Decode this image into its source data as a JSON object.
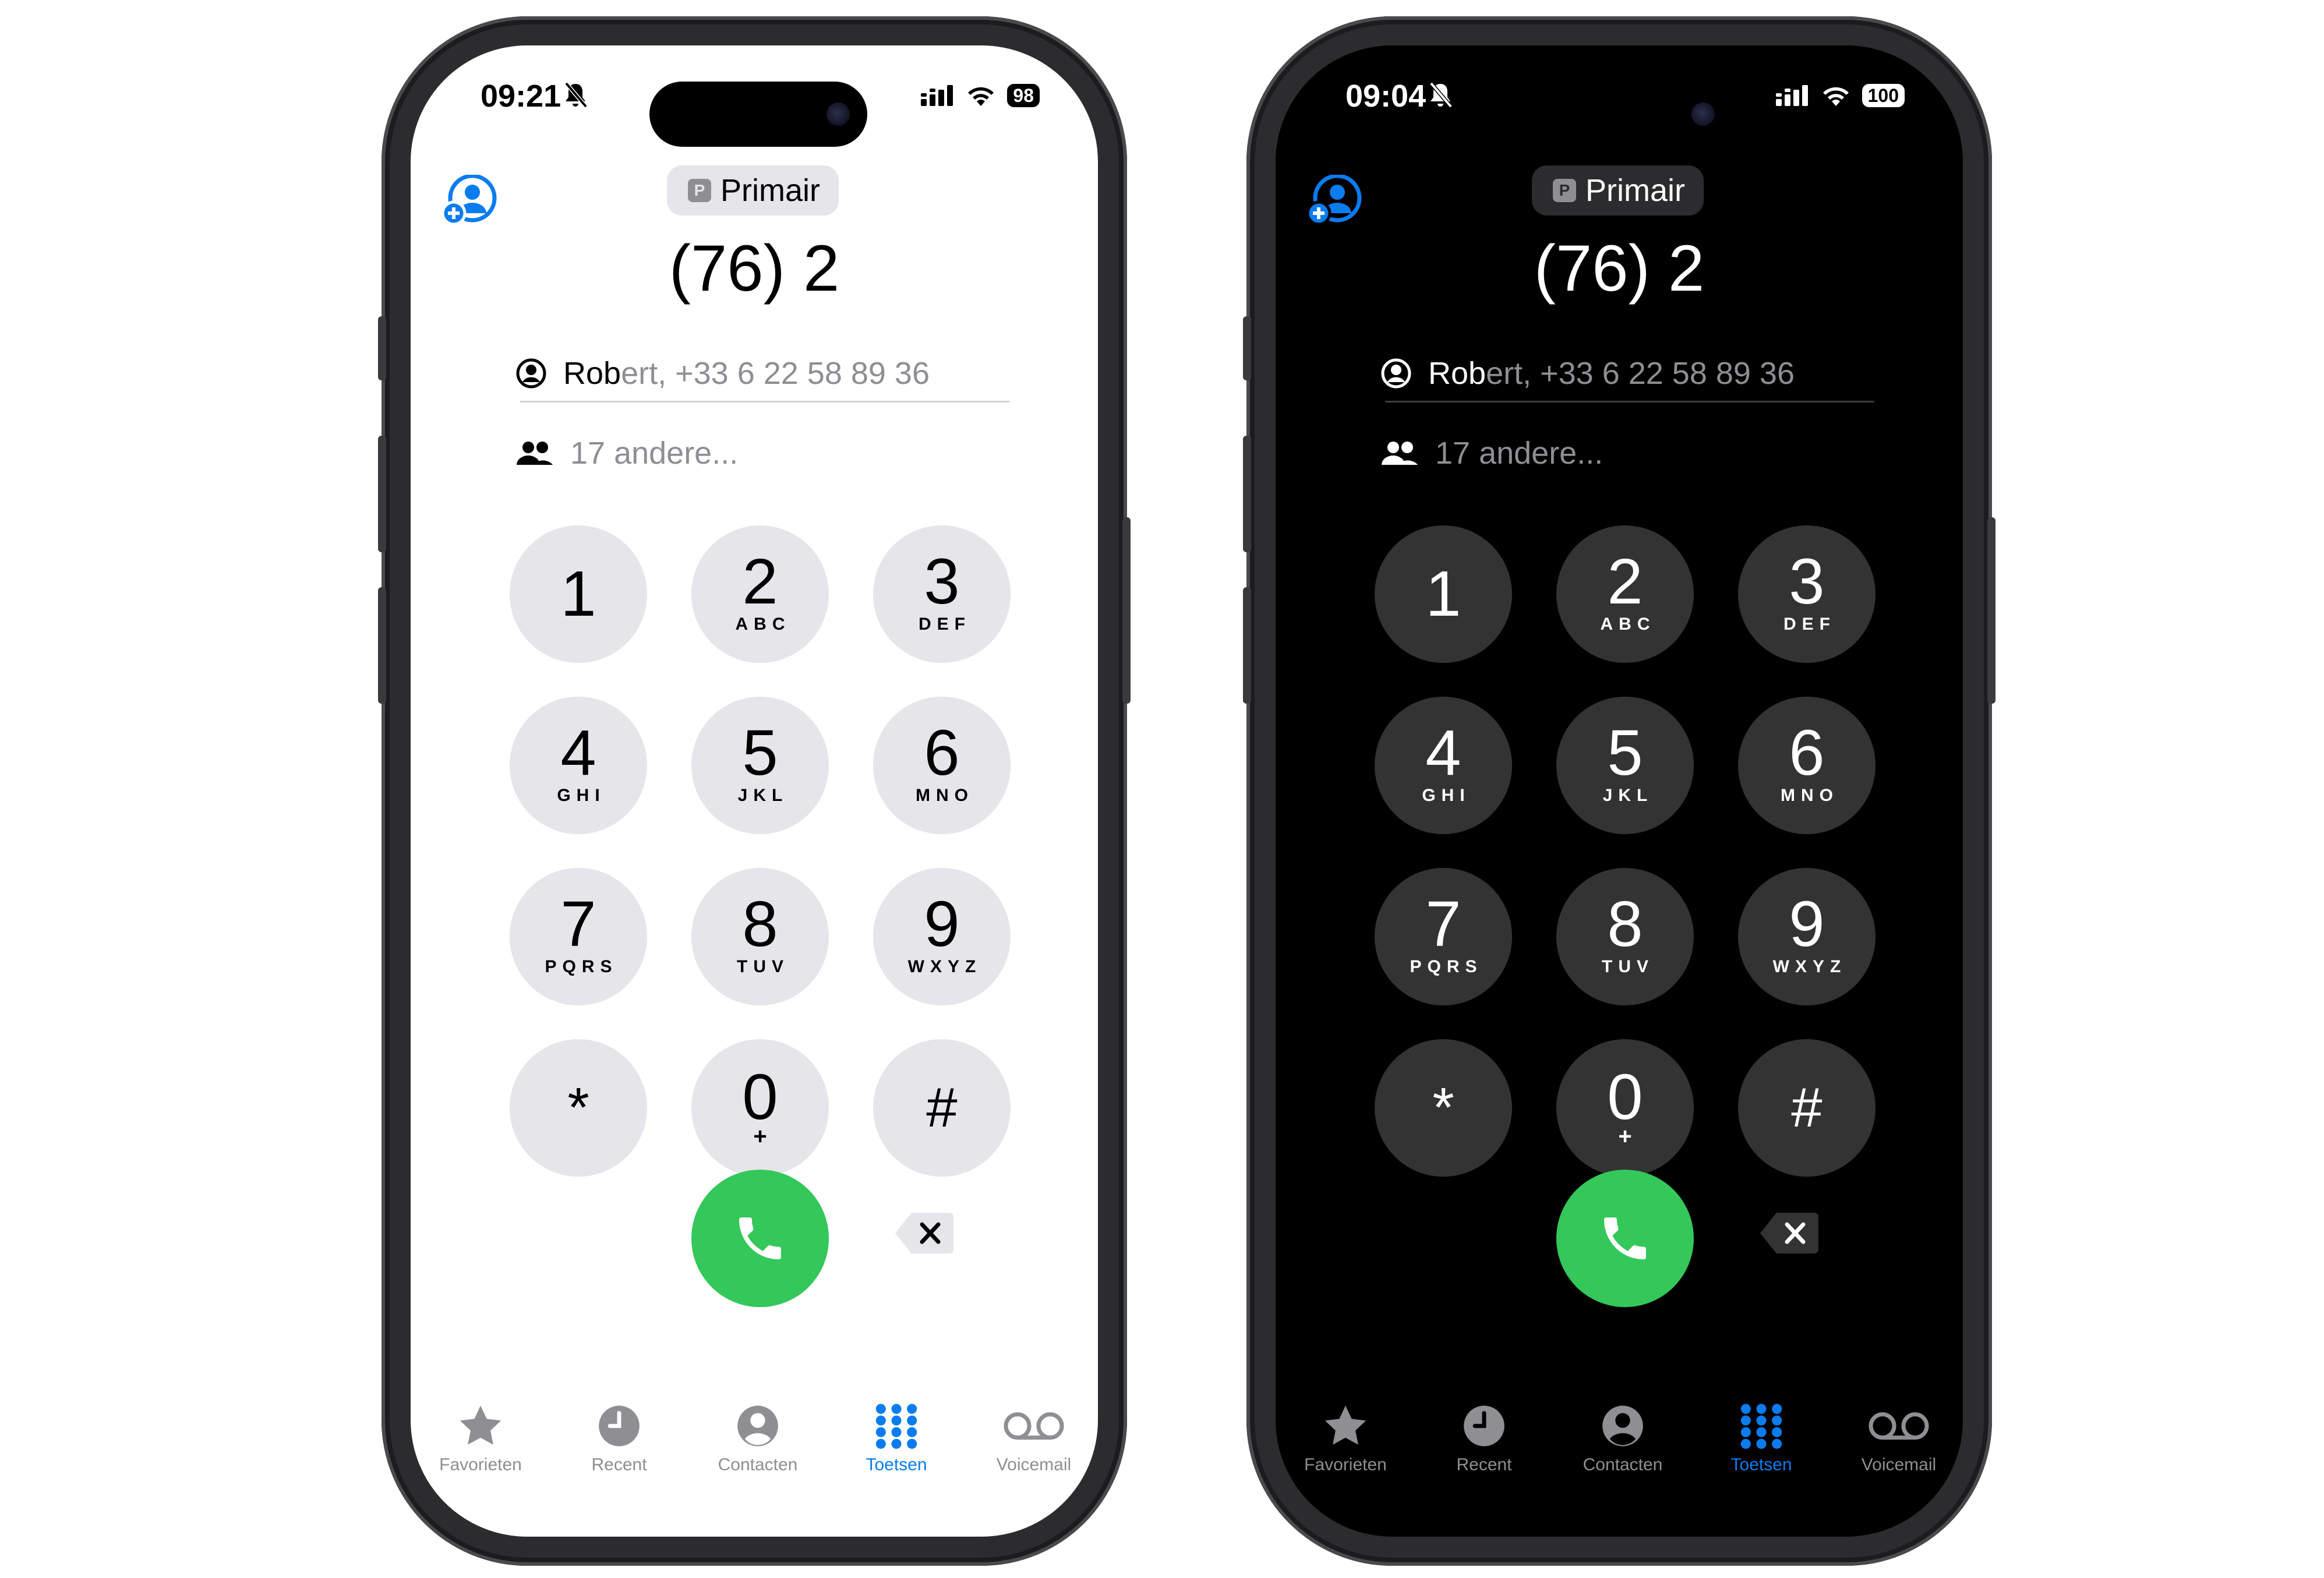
{
  "status": {
    "time_left": "09:21",
    "battery_left": "98",
    "time_right": "09:04",
    "battery_right": "100"
  },
  "line_badge": {
    "letter": "P",
    "label": "Primair"
  },
  "dialed_number": "(76) 2",
  "suggestion": {
    "match": "Rob",
    "rest": "ert, +33 6 22 58 89 36"
  },
  "others": "17 andere...",
  "keypad": [
    {
      "digit": "1",
      "letters": ""
    },
    {
      "digit": "2",
      "letters": "ABC"
    },
    {
      "digit": "3",
      "letters": "DEF"
    },
    {
      "digit": "4",
      "letters": "GHI"
    },
    {
      "digit": "5",
      "letters": "JKL"
    },
    {
      "digit": "6",
      "letters": "MNO"
    },
    {
      "digit": "7",
      "letters": "PQRS"
    },
    {
      "digit": "8",
      "letters": "TUV"
    },
    {
      "digit": "9",
      "letters": "WXYZ"
    },
    {
      "digit": "*",
      "letters": ""
    },
    {
      "digit": "0",
      "letters": "+"
    },
    {
      "digit": "#",
      "letters": ""
    }
  ],
  "tabs": [
    {
      "label": "Favorieten",
      "icon": "star-icon"
    },
    {
      "label": "Recent",
      "icon": "clock-icon"
    },
    {
      "label": "Contacten",
      "icon": "person-circle-icon"
    },
    {
      "label": "Toetsen",
      "icon": "keypad-icon",
      "active": true
    },
    {
      "label": "Voicemail",
      "icon": "voicemail-icon"
    }
  ],
  "colors": {
    "accent": "#0a7cf0",
    "call_green": "#34c759",
    "key_light": "#e5e5ea",
    "key_dark": "#333333"
  }
}
